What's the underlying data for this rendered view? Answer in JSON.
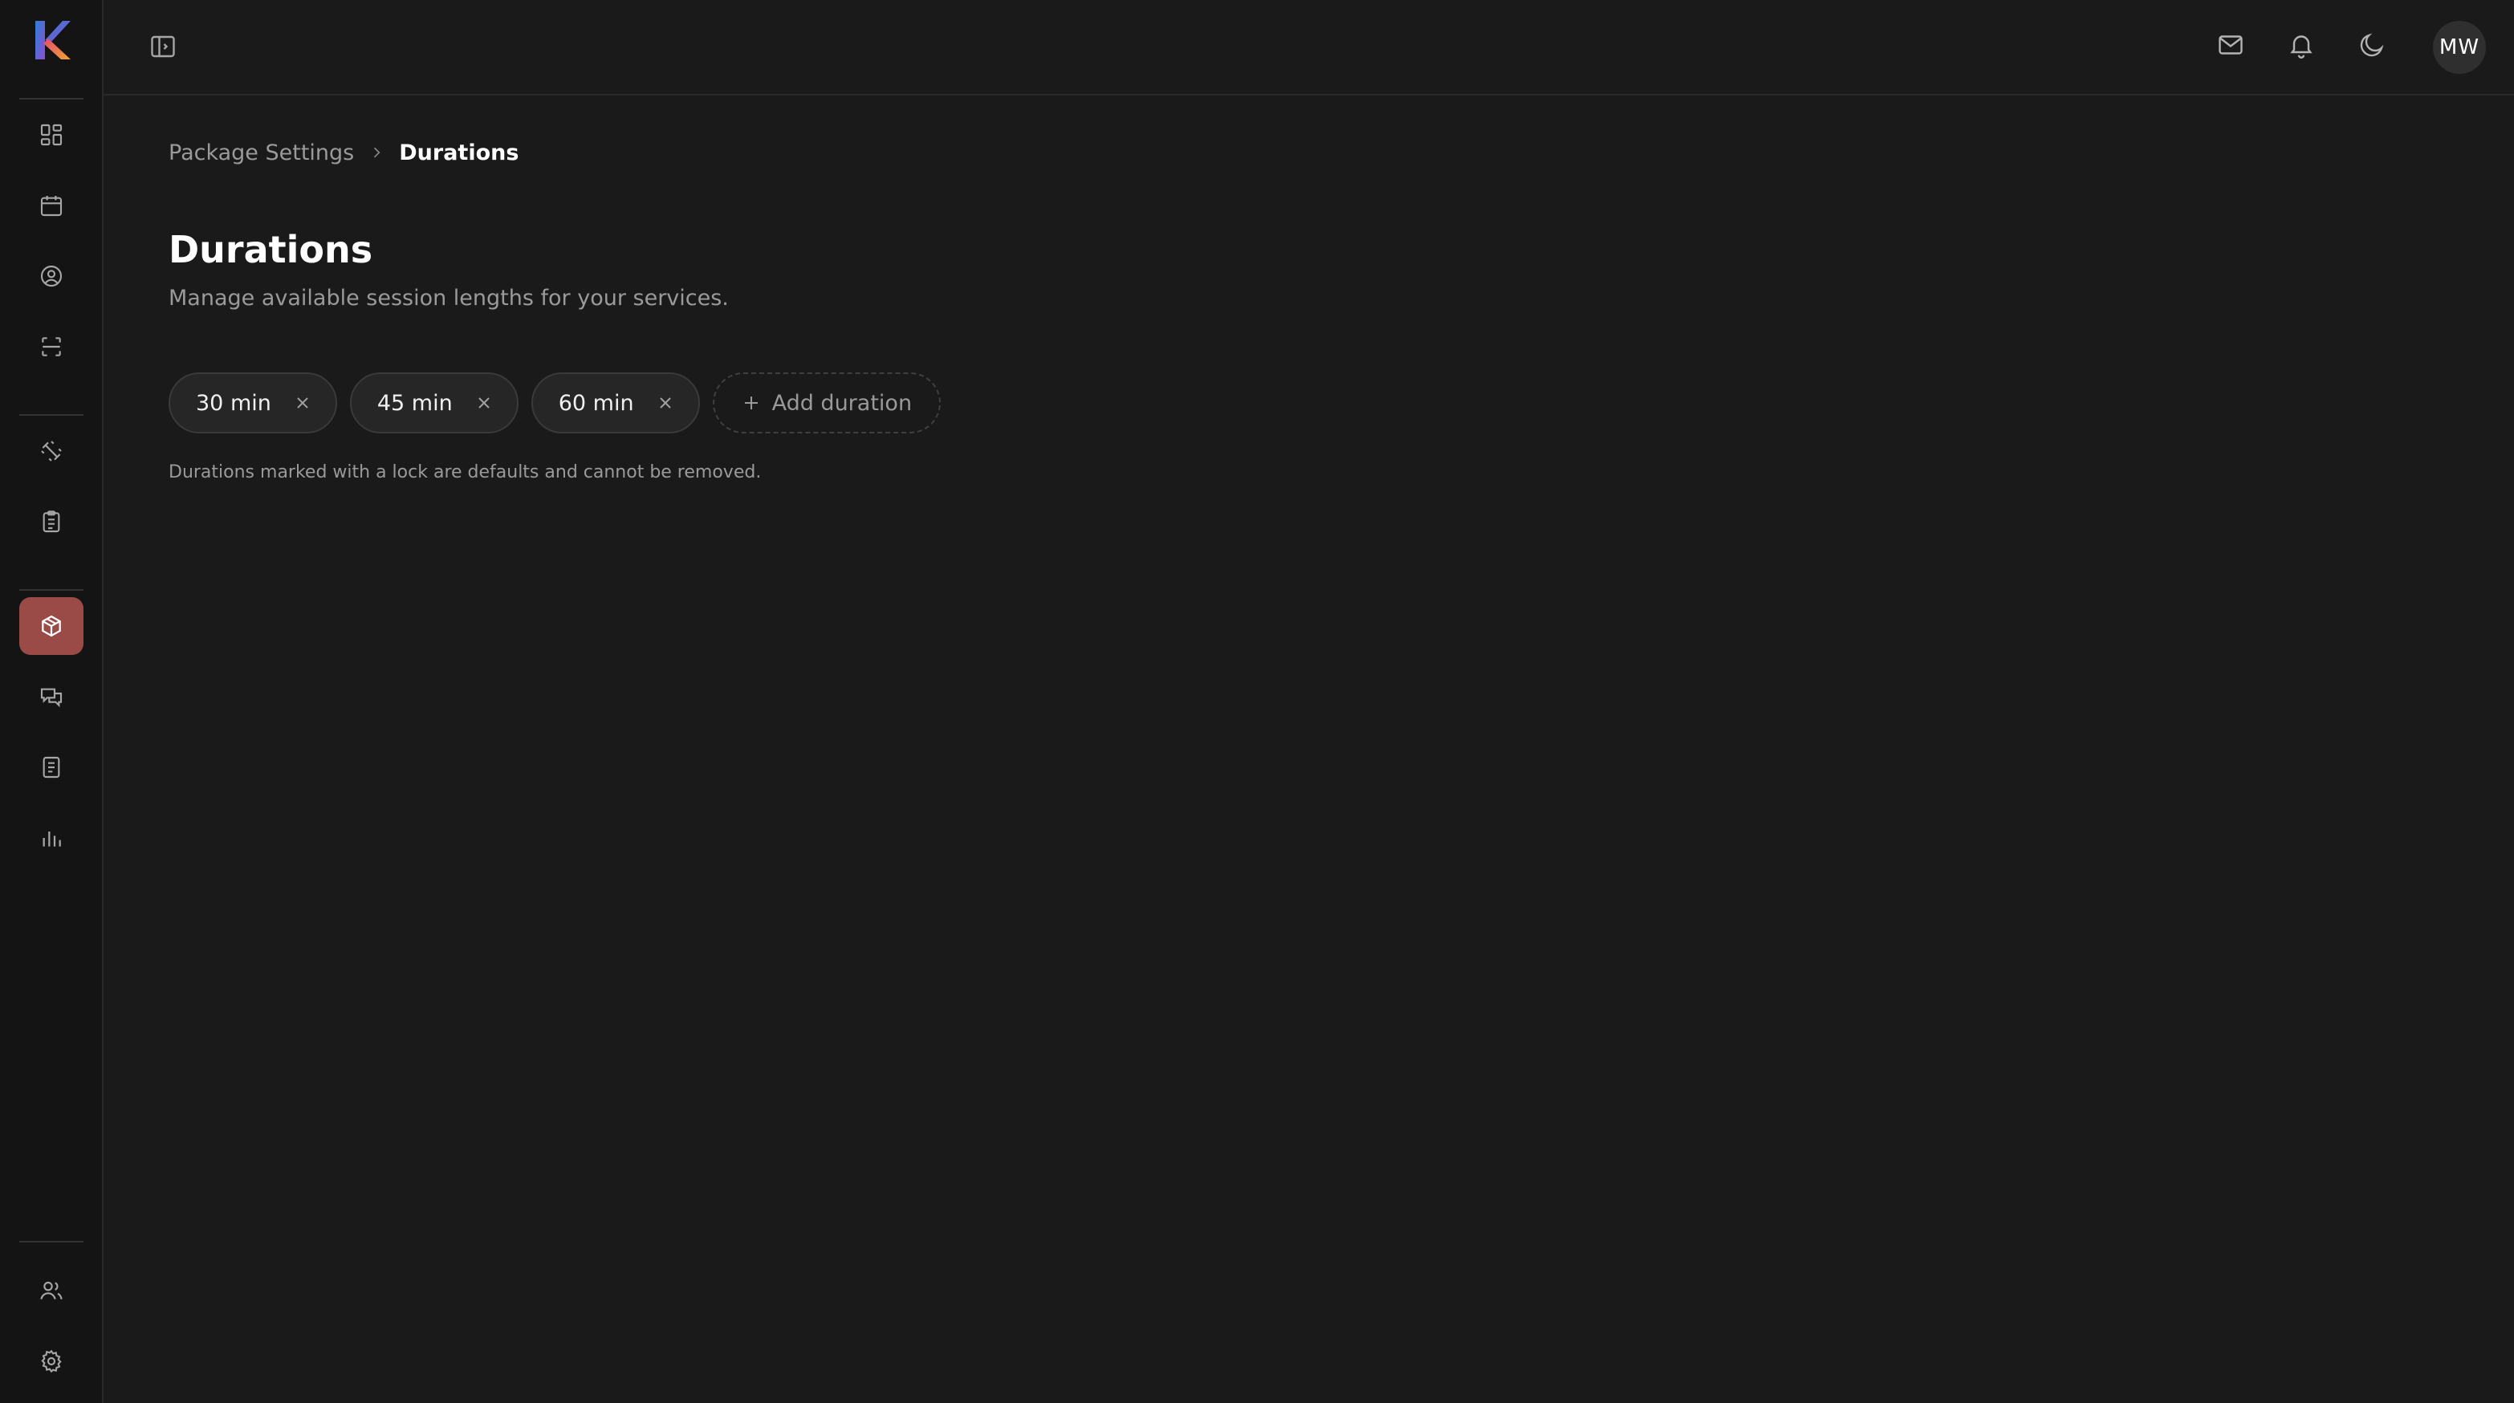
{
  "header": {
    "avatar_initials": "MW",
    "icons": [
      "panel-toggle-icon",
      "mail-icon",
      "bell-icon",
      "moon-icon"
    ]
  },
  "sidebar": {
    "active": "packages",
    "items": [
      {
        "key": "dashboard",
        "icon": "dashboard-icon"
      },
      {
        "key": "calendar",
        "icon": "calendar-icon"
      },
      {
        "key": "profile",
        "icon": "user-circle-icon"
      },
      {
        "key": "scan",
        "icon": "scan-icon"
      },
      {
        "key": "fitness",
        "icon": "dumbbell-icon"
      },
      {
        "key": "checklist",
        "icon": "clipboard-icon"
      },
      {
        "key": "packages",
        "icon": "package-icon"
      },
      {
        "key": "messages",
        "icon": "chat-icon"
      },
      {
        "key": "documents",
        "icon": "document-icon"
      },
      {
        "key": "reports",
        "icon": "bar-chart-icon"
      },
      {
        "key": "team",
        "icon": "users-icon"
      },
      {
        "key": "settings",
        "icon": "gear-icon"
      }
    ],
    "accent_color": "#9b4b47"
  },
  "breadcrumb": {
    "parent": "Package Settings",
    "current": "Durations"
  },
  "page": {
    "title": "Durations",
    "subtitle": "Manage available session lengths for your services.",
    "durations": [
      "30 min",
      "45 min",
      "60 min"
    ],
    "add_label": "Add duration",
    "note": "Durations marked with a lock are defaults and cannot be removed."
  }
}
